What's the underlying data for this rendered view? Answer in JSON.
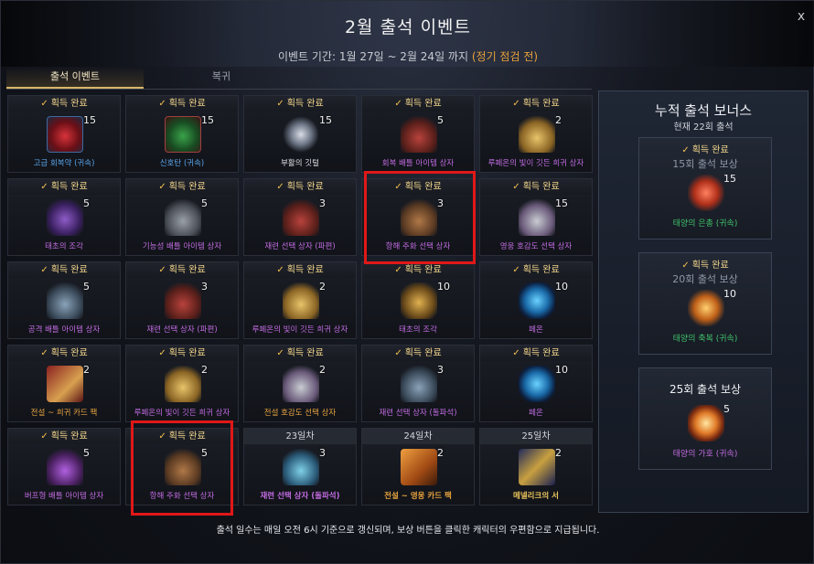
{
  "header": {
    "title": "2월 출석 이벤트",
    "period_prefix": "이벤트 기간: 1월 27일 ~ 2월 24일 까지",
    "period_note": "(정기 점검 전)",
    "close_label": "x"
  },
  "tabs": [
    {
      "label": "출석 이벤트",
      "active": true
    },
    {
      "label": "복귀",
      "active": false
    }
  ],
  "completed_label": "획득 완료",
  "check_glyph": "✓",
  "days": [
    {
      "status": "완료",
      "qty": "15",
      "name": "고급 회복약 (귀속)",
      "name_color": "blue",
      "icon": "potion-red"
    },
    {
      "status": "완료",
      "qty": "15",
      "name": "신호탄 (귀속)",
      "name_color": "blue",
      "icon": "potion-green"
    },
    {
      "status": "완료",
      "qty": "15",
      "name": "부활의 깃털",
      "name_color": "white",
      "icon": "feather"
    },
    {
      "status": "완료",
      "qty": "5",
      "name": "회복 배틀 아이템 상자",
      "name_color": "purple",
      "icon": "chest-red"
    },
    {
      "status": "완료",
      "qty": "2",
      "name": "루페온의 빛이 깃든 희귀 상자",
      "name_color": "purple",
      "icon": "chest-gold"
    },
    {
      "status": "완료",
      "qty": "5",
      "name": "태초의 조각",
      "name_color": "purple",
      "icon": "book-purple"
    },
    {
      "status": "완료",
      "qty": "5",
      "name": "기능성 배틀 아이템 상자",
      "name_color": "purple",
      "icon": "chest-gray"
    },
    {
      "status": "완료",
      "qty": "3",
      "name": "재련 선택 상자 (파편)",
      "name_color": "purple",
      "icon": "chest-red"
    },
    {
      "status": "완료",
      "qty": "3",
      "name": "항해 주화 선택 상자",
      "name_color": "purple",
      "icon": "chest-brown"
    },
    {
      "status": "완료",
      "qty": "15",
      "name": "영웅 호감도 선택 상자",
      "name_color": "purple",
      "icon": "chest-silver"
    },
    {
      "status": "완료",
      "qty": "5",
      "name": "공격 배틀 아이템 상자",
      "name_color": "purple",
      "icon": "chest-steel"
    },
    {
      "status": "완료",
      "qty": "3",
      "name": "재련 선택 상자 (파편)",
      "name_color": "purple",
      "icon": "chest-red"
    },
    {
      "status": "완료",
      "qty": "2",
      "name": "루페온의 빛이 깃든 희귀 상자",
      "name_color": "purple",
      "icon": "chest-gold"
    },
    {
      "status": "완료",
      "qty": "10",
      "name": "태초의 조각",
      "name_color": "purple",
      "icon": "book-gold"
    },
    {
      "status": "완료",
      "qty": "10",
      "name": "페온",
      "name_color": "purple",
      "icon": "rune-blue"
    },
    {
      "status": "완료",
      "qty": "2",
      "name": "전설 ~ 희귀 카드 팩",
      "name_color": "orange",
      "icon": "card-red"
    },
    {
      "status": "완료",
      "qty": "2",
      "name": "루페온의 빛이 깃든 희귀 상자",
      "name_color": "purple",
      "icon": "chest-gold"
    },
    {
      "status": "완료",
      "qty": "2",
      "name": "전설 호감도 선택 상자",
      "name_color": "orange",
      "icon": "chest-silver"
    },
    {
      "status": "완료",
      "qty": "3",
      "name": "재련 선택 상자 (돌파석)",
      "name_color": "purple",
      "icon": "chest-steel"
    },
    {
      "status": "완료",
      "qty": "10",
      "name": "페온",
      "name_color": "purple",
      "icon": "rune-blue"
    },
    {
      "status": "완료",
      "qty": "5",
      "name": "버프형 배틀 아이템 상자",
      "name_color": "purple",
      "icon": "chest-purple"
    },
    {
      "status": "완료",
      "qty": "5",
      "name": "항해 주화 선택 상자",
      "name_color": "purple",
      "icon": "chest-brown"
    },
    {
      "status": "23일차",
      "qty": "3",
      "name": "재련 선택 상자 (돌파석)",
      "name_color": "purple",
      "icon": "chest-teal"
    },
    {
      "status": "24일차",
      "qty": "2",
      "name": "전설 ~ 영웅 카드 팩",
      "name_color": "orange",
      "icon": "card-orange"
    },
    {
      "status": "25일차",
      "qty": "2",
      "name": "메넬리크의 서",
      "name_color": "gold",
      "icon": "card-blue"
    }
  ],
  "bonus": {
    "title": "누적 출석 보너스",
    "current": "현재 22회 출석",
    "rewards": [
      {
        "completed": true,
        "label": "15회 출석 보상",
        "qty": "15",
        "name": "태양의 은총 (귀속)",
        "icon": "gem-red"
      },
      {
        "completed": true,
        "label": "20회 출석 보상",
        "qty": "10",
        "name": "태양의 축복 (귀속)",
        "icon": "gem-orange"
      },
      {
        "completed": false,
        "label": "25회 출석 보상",
        "qty": "5",
        "name": "태양의 가호 (귀속)",
        "icon": "gem-sun"
      }
    ]
  },
  "footer": "출석 일수는 매일 오전 6시 기준으로 갱신되며, 보상 버튼을 클릭한 캐릭터의 우편함으로 지급됩니다.",
  "colors": {
    "accent_gold": "#f0d48a",
    "highlight_red": "#e01818",
    "name_blue": "#5aa4e8",
    "name_purple": "#c06be0",
    "name_orange": "#e7a33f",
    "name_green": "#3fc06a"
  }
}
